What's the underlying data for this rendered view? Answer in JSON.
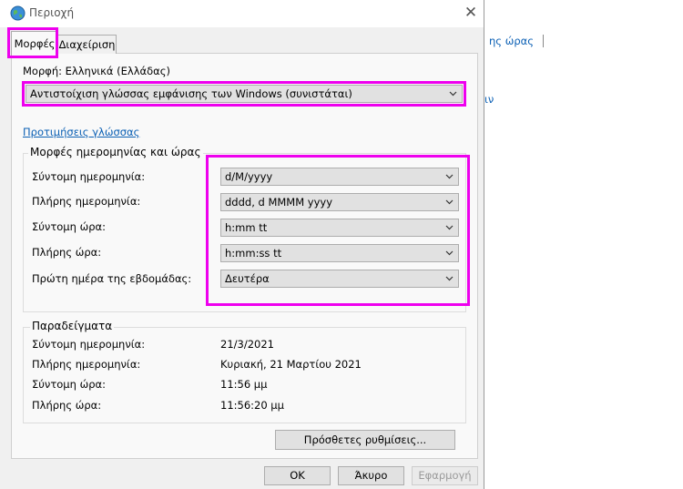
{
  "window": {
    "title": "Περιοχή",
    "icon": "globe-icon",
    "close": "✕"
  },
  "background": {
    "link1": "ης ώρας",
    "link2": "ιν"
  },
  "tabs": [
    {
      "label": "Μορφές",
      "active": true
    },
    {
      "label": "Διαχείριση",
      "active": false
    }
  ],
  "format": {
    "label": "Μορφή: Ελληνικά (Ελλάδας)",
    "selected": "Αντιστοίχιση γλώσσας εμφάνισης των Windows (συνιστάται)"
  },
  "language_prefs_link": "Προτιμήσεις γλώσσας",
  "date_time_formats": {
    "title": "Μορφές ημερομηνίας και ώρας",
    "rows": [
      {
        "label": "Σύντομη ημερομηνία:",
        "value": "d/M/yyyy"
      },
      {
        "label": "Πλήρης ημερομηνία:",
        "value": "dddd, d MMMM yyyy"
      },
      {
        "label": "Σύντομη ώρα:",
        "value": "h:mm tt"
      },
      {
        "label": "Πλήρης ώρα:",
        "value": "h:mm:ss tt"
      },
      {
        "label": "Πρώτη ημέρα της εβδομάδας:",
        "value": "Δευτέρα"
      }
    ]
  },
  "examples": {
    "title": "Παραδείγματα",
    "rows": [
      {
        "label": "Σύντομη ημερομηνία:",
        "value": "21/3/2021"
      },
      {
        "label": "Πλήρης ημερομηνία:",
        "value": "Κυριακή, 21 Μαρτίου 2021"
      },
      {
        "label": "Σύντομη ώρα:",
        "value": "11:56 μμ"
      },
      {
        "label": "Πλήρης ώρα:",
        "value": "11:56:20 μμ"
      }
    ]
  },
  "buttons": {
    "additional": "Πρόσθετες ρυθμίσεις...",
    "ok": "OK",
    "cancel": "Άκυρο",
    "apply": "Εφαρμογή"
  },
  "colors": {
    "highlight": "#ee00ee",
    "link": "#0a5fb4"
  }
}
